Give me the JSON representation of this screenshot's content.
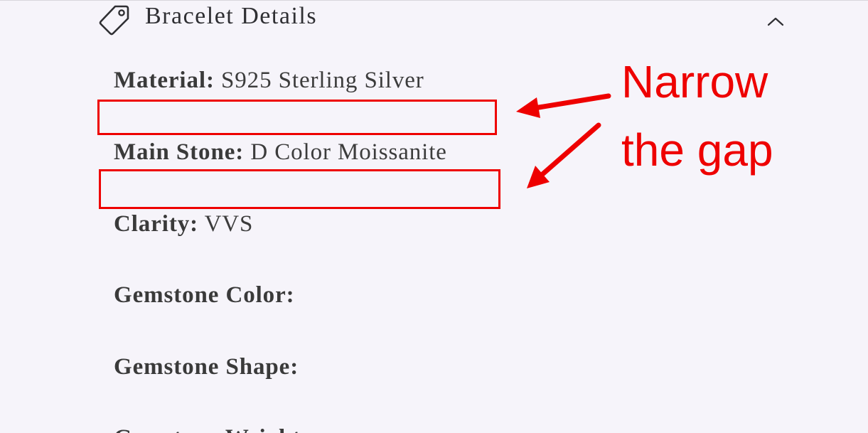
{
  "accordion": {
    "icon": "tag-icon",
    "title": "Bracelet Details",
    "toggle_icon": "chevron-up-icon",
    "expanded": true
  },
  "details": [
    {
      "label": "Material:",
      "value": "S925 Sterling Silver"
    },
    {
      "label": "Main Stone:",
      "value": "D Color Moissanite"
    },
    {
      "label": "Clarity:",
      "value": "VVS"
    },
    {
      "label": "Gemstone Color:",
      "value": ""
    },
    {
      "label": "Gemstone Shape:",
      "value": ""
    },
    {
      "label": "Gemstone Weight:",
      "value": ""
    }
  ],
  "annotation": {
    "line1": "Narrow",
    "line2": "the gap",
    "color": "#ee0000"
  },
  "colors": {
    "background": "#f6f4fa",
    "text": "#3a3a3a",
    "annotation": "#ee0000"
  }
}
